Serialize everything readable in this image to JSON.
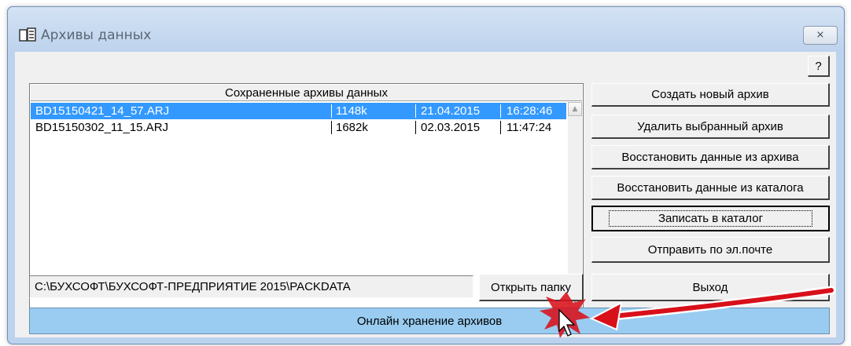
{
  "window": {
    "title": "Архивы данных",
    "close_label": "⨯"
  },
  "toolbar": {
    "help_label": "?"
  },
  "archives": {
    "header": "Сохраненные архивы данных",
    "rows": [
      {
        "name": "BD15150421_14_57.ARJ",
        "size": "1148k",
        "date": "21.04.2015",
        "time": "16:28:46",
        "selected": true
      },
      {
        "name": "BD15150302_11_15.ARJ",
        "size": "1682k",
        "date": "02.03.2015",
        "time": "11:47:24",
        "selected": false
      }
    ]
  },
  "actions": {
    "create": "Создать новый архив",
    "delete": "Удалить выбранный архив",
    "restore_archive": "Восстановить данные из архива",
    "restore_catalog": "Восстановить данные из каталога",
    "write_catalog": "Записать в каталог",
    "send_email": "Отправить по эл.почте",
    "exit": "Выход",
    "open_folder": "Открыть папку",
    "online_storage": "Онлайн хранение архивов"
  },
  "path": {
    "value": "C:\\БУХСОФТ\\БУХСОФТ-ПРЕДПРИЯТИЕ 2015\\PACKDATA"
  },
  "colors": {
    "selection": "#3399ff",
    "online_button": "#99ccf0",
    "arrow": "#d8101a"
  }
}
